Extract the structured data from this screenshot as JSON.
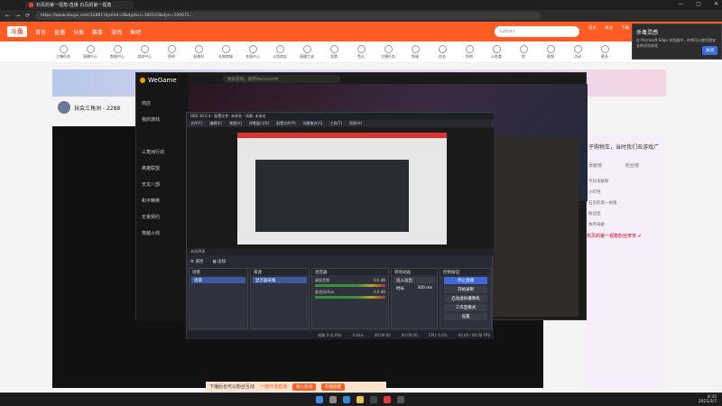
{
  "browser": {
    "tab_title": "石页的第一视角-直播 石页的第一视角",
    "url": "https://www.douyu.com/12881?dyshid=0&dyshci=100103&dyn=100071...",
    "back": "←",
    "forward": "→",
    "refresh": "⟳",
    "win_controls": [
      "—",
      "▢",
      "✕"
    ]
  },
  "site": {
    "logo": "斗鱼",
    "nav": [
      "首页",
      "直播",
      "分类",
      "赛事",
      "游戏",
      "鱼吧"
    ],
    "search_placeholder": "Labian",
    "header_icons": [
      "历史",
      "关注",
      "下载"
    ],
    "categories": [
      "主播任务",
      "直播中心",
      "数据中心",
      "游戏中心",
      "鱼吧",
      "直播间",
      "礼物商城",
      "充值中心",
      "斗鱼商店",
      "直播工具",
      "竞猜",
      "鱼丸",
      "主播任务",
      "鱼塘",
      "任务",
      "鱼吧",
      "斗鱼看",
      "鱼",
      "视频",
      "活动",
      "更多"
    ],
    "streamer_name": "玩会三角洲 - 2288",
    "chat": {
      "title": "子购物车，当时我们去游戏广",
      "tabs": [
        "贡献榜",
        "粉丝榜"
      ],
      "messages": [
        "今日贡献榜",
        "小铃铛",
        "石页的第一视角",
        "粉丝团",
        "本月贡献"
      ],
      "follow_text": "石页的第一视角粉丝宋宋 ✔"
    }
  },
  "edge_popup": {
    "title": "杀毒灵感",
    "text": "在 Microsoft Edge 浏览器中，你将可以使用更安全的浏览体验",
    "button": "关闭"
  },
  "wegame": {
    "logo": "WeGame",
    "search_placeholder": "搜索游戏，使用WeGame中",
    "sidebar": [
      "商店",
      "我的游戏",
      "三角洲行动",
      "英雄联盟",
      "天龙八部",
      "和平精英",
      "无畏契约",
      "穿越火线"
    ]
  },
  "obs": {
    "title": "OBS 30.0.4 - 配置文件: 未命名 - 场景: 未命名",
    "menu": [
      "文件(F)",
      "编辑(E)",
      "视图(V)",
      "停靠窗口(D)",
      "配置文件(P)",
      "场景集合(S)",
      "工具(T)",
      "帮助(H)"
    ],
    "status_source": "未选择源",
    "toolbar": [
      "⚙ 属性",
      "▦ 滤镜"
    ],
    "scenes": {
      "header": "场景",
      "items": [
        "场景"
      ]
    },
    "sources": {
      "header": "来源",
      "items": [
        "显示器采集"
      ]
    },
    "mixer": {
      "header": "混音器",
      "channels": [
        {
          "name": "桌面音频",
          "level": "0.0 dB"
        },
        {
          "name": "麦克风/Aux",
          "level": "0.0 dB"
        }
      ]
    },
    "transitions": {
      "header": "转场动画",
      "type": "淡入淡出",
      "duration_label": "时长",
      "duration": "300 ms"
    },
    "controls": {
      "header": "控制按钮",
      "buttons": [
        "停止直播",
        "开始录制",
        "启动虚拟摄像机",
        "工作室模式",
        "设置"
      ]
    },
    "footer": [
      "帧数 0 (0.0%)",
      "0 kb/s",
      "00:00:00",
      "00:00:00",
      "CPU: 0.6%",
      "60.00 / 60.00 FPS"
    ]
  },
  "promo": {
    "text": "下播后也可以粉丝互动",
    "link": "一键开通直播",
    "btn1": "进入房间",
    "btn2": "开播提醒"
  },
  "taskbar": {
    "time": "8:35",
    "date": "2025/3/7"
  },
  "colors": {
    "brand": "#ff5d23",
    "obs_bg": "#272a33",
    "obs_accent": "#3d6ad8"
  }
}
